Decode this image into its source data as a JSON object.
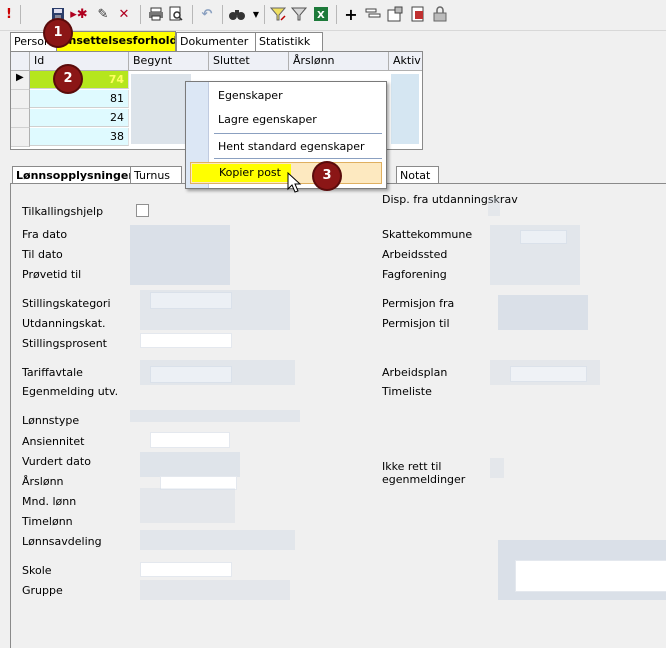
{
  "toolbar": {
    "icons": [
      "exclamation-icon",
      "save-icon",
      "new-record-icon",
      "edit-icon",
      "delete-icon",
      "print-icon",
      "print-preview-icon",
      "undo-icon",
      "find-icon",
      "dropdown-arrow-icon",
      "filter-edit-icon",
      "filter-icon",
      "excel-icon",
      "add-icon",
      "layout-icon",
      "properties-icon",
      "report-icon",
      "lock-icon"
    ]
  },
  "top_tabs": [
    "Person",
    "Ansettelsesforhold",
    "Dokumenter",
    "Statistikk"
  ],
  "grid": {
    "columns": [
      "Id",
      "Begynt",
      "Sluttet",
      "Årslønn",
      "Aktiv"
    ],
    "rows": [
      "74",
      "81",
      "24",
      "38"
    ]
  },
  "context_menu": {
    "items": [
      "Egenskaper",
      "Lagre egenskaper",
      "Hent standard egenskaper",
      "Kopier post"
    ]
  },
  "badges": [
    "1",
    "2",
    "3"
  ],
  "bottom_tabs": [
    "Lønnsopplysninger",
    "Turnus",
    "Notat"
  ],
  "left_labels": [
    "Tilkallingshjelp",
    "Fra dato",
    "Til dato",
    "Prøvetid til",
    "Stillingskategori",
    "Utdanningskat.",
    "Stillingsprosent",
    "Tariffavtale",
    "Egenmelding utv.",
    "Lønnstype",
    "Ansiennitet",
    "Vurdert dato",
    "Årslønn",
    "Mnd. lønn",
    "Timelønn",
    "Lønnsavdeling",
    "Skole",
    "Gruppe"
  ],
  "right_labels": [
    "Disp. fra utdanningskrav",
    "Skattekommune",
    "Arbeidssted",
    "Fagforening",
    "Permisjon fra",
    "Permisjon til",
    "Arbeidsplan",
    "Timeliste",
    "Ikke rett til egenmeldinger"
  ],
  "colors": {
    "highlight": "#ffff00",
    "badge": "#8b1616",
    "row_bg": "#dffaff",
    "menu_hover": "#fde9c0"
  }
}
